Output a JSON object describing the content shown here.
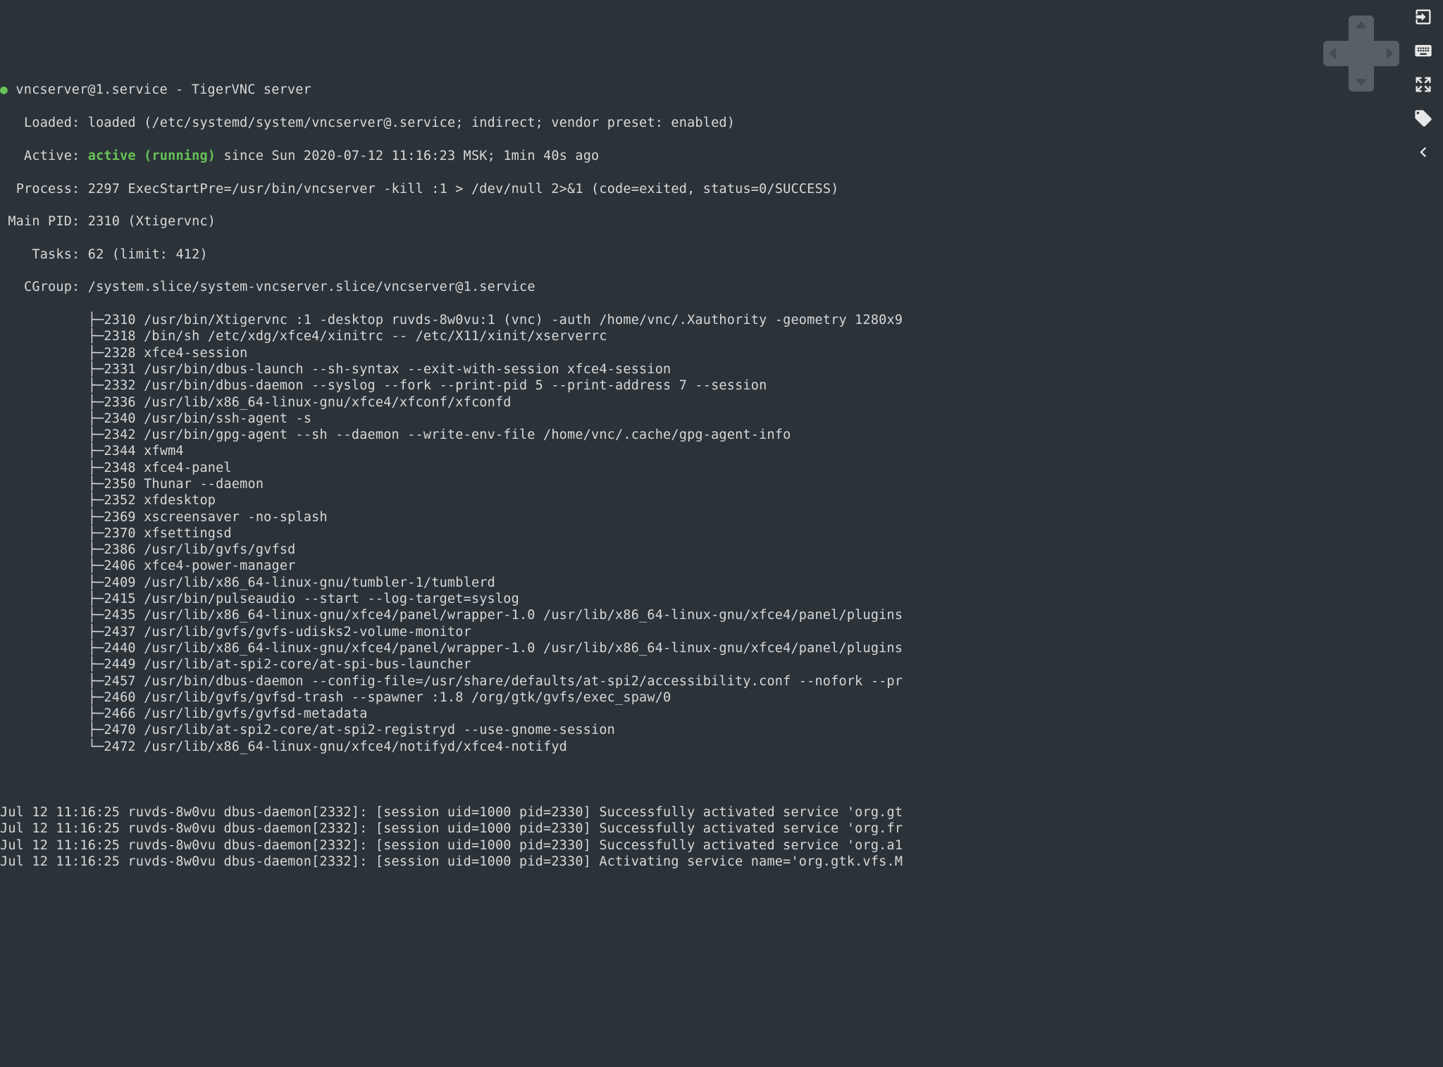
{
  "status": {
    "unit": "vncserver@1.service",
    "description": "TigerVNC server",
    "loaded_label": "Loaded:",
    "loaded_value": "loaded (/etc/systemd/system/vncserver@.service; indirect; vendor preset: enabled)",
    "active_label": "Active:",
    "active_state": "active (running)",
    "active_since": " since Sun 2020-07-12 11:16:23 MSK; 1min 40s ago",
    "process_label": "Process:",
    "process_value": "2297 ExecStartPre=/usr/bin/vncserver -kill :1 > /dev/null 2>&1 (code=exited, status=0/SUCCESS)",
    "mainpid_label": "Main PID:",
    "mainpid_value": "2310 (Xtigervnc)",
    "tasks_label": "Tasks:",
    "tasks_value": "62 (limit: 412)",
    "cgroup_label": "CGroup:",
    "cgroup_path": "/system.slice/system-vncserver.slice/vncserver@1.service"
  },
  "cgroup_tree": [
    "├─2310 /usr/bin/Xtigervnc :1 -desktop ruvds-8w0vu:1 (vnc) -auth /home/vnc/.Xauthority -geometry 1280x9",
    "├─2318 /bin/sh /etc/xdg/xfce4/xinitrc -- /etc/X11/xinit/xserverrc",
    "├─2328 xfce4-session",
    "├─2331 /usr/bin/dbus-launch --sh-syntax --exit-with-session xfce4-session",
    "├─2332 /usr/bin/dbus-daemon --syslog --fork --print-pid 5 --print-address 7 --session",
    "├─2336 /usr/lib/x86_64-linux-gnu/xfce4/xfconf/xfconfd",
    "├─2340 /usr/bin/ssh-agent -s",
    "├─2342 /usr/bin/gpg-agent --sh --daemon --write-env-file /home/vnc/.cache/gpg-agent-info",
    "├─2344 xfwm4",
    "├─2348 xfce4-panel",
    "├─2350 Thunar --daemon",
    "├─2352 xfdesktop",
    "├─2369 xscreensaver -no-splash",
    "├─2370 xfsettingsd",
    "├─2386 /usr/lib/gvfs/gvfsd",
    "├─2406 xfce4-power-manager",
    "├─2409 /usr/lib/x86_64-linux-gnu/tumbler-1/tumblerd",
    "├─2415 /usr/bin/pulseaudio --start --log-target=syslog",
    "├─2435 /usr/lib/x86_64-linux-gnu/xfce4/panel/wrapper-1.0 /usr/lib/x86_64-linux-gnu/xfce4/panel/plugins",
    "├─2437 /usr/lib/gvfs/gvfs-udisks2-volume-monitor",
    "├─2440 /usr/lib/x86_64-linux-gnu/xfce4/panel/wrapper-1.0 /usr/lib/x86_64-linux-gnu/xfce4/panel/plugins",
    "├─2449 /usr/lib/at-spi2-core/at-spi-bus-launcher",
    "├─2457 /usr/bin/dbus-daemon --config-file=/usr/share/defaults/at-spi2/accessibility.conf --nofork --pr",
    "├─2460 /usr/lib/gvfs/gvfsd-trash --spawner :1.8 /org/gtk/gvfs/exec_spaw/0",
    "├─2466 /usr/lib/gvfs/gvfsd-metadata",
    "├─2470 /usr/lib/at-spi2-core/at-spi2-registryd --use-gnome-session",
    "└─2472 /usr/lib/x86_64-linux-gnu/xfce4/notifyd/xfce4-notifyd"
  ],
  "journal": [
    "Jul 12 11:16:25 ruvds-8w0vu dbus-daemon[2332]: [session uid=1000 pid=2330] Successfully activated service 'org.gt",
    "Jul 12 11:16:25 ruvds-8w0vu dbus-daemon[2332]: [session uid=1000 pid=2330] Successfully activated service 'org.fr",
    "Jul 12 11:16:25 ruvds-8w0vu dbus-daemon[2332]: [session uid=1000 pid=2330] Successfully activated service 'org.a1",
    "Jul 12 11:16:25 ruvds-8w0vu dbus-daemon[2332]: [session uid=1000 pid=2330] Activating service name='org.gtk.vfs.M"
  ],
  "toolbar": {
    "exit": "exit",
    "keyboard": "keyboard",
    "fullscreen": "fullscreen",
    "tag": "tag",
    "back": "back"
  }
}
